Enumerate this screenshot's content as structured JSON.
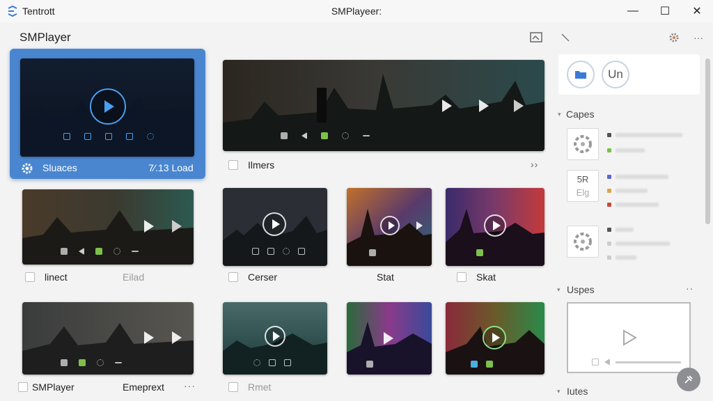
{
  "titlebar": {
    "app_name": "Tentrott",
    "window_title": "SMPlayeer:",
    "minimize_glyph": "—",
    "maximize_glyph": "☐",
    "close_glyph": "✕"
  },
  "header": {
    "title": "SMPlayer",
    "icons": [
      "screenshot-icon",
      "pencil-icon",
      "settings-icon",
      "more-icon"
    ],
    "more_glyph": "···"
  },
  "selected_card": {
    "label": "Sluaces",
    "status": "7⁄.13 Load",
    "icon": "gear-icon"
  },
  "cards": [
    {
      "id": "wide-top",
      "label": "Ilmers",
      "more": "››"
    },
    {
      "id": "row2-c1",
      "label": "linect",
      "meta": "Eilad"
    },
    {
      "id": "row2-c2",
      "label": "Cerser"
    },
    {
      "id": "row2-c3",
      "label": "Stat"
    },
    {
      "id": "row2-c4",
      "label": "Skat"
    },
    {
      "id": "row3-c1",
      "label": "SMPlayer",
      "meta": "Emeprext",
      "more": "···"
    },
    {
      "id": "row3-c2",
      "label": "Rmet"
    }
  ],
  "right_panel": {
    "top_button_text": "Un",
    "sections": [
      {
        "title": "Capes",
        "arrow": "▾"
      },
      {
        "title": "Uspes",
        "arrow": "▾",
        "more": "··"
      },
      {
        "title": "Iutes"
      }
    ],
    "tile_texts": [
      "5R",
      "Elg"
    ]
  },
  "colors": {
    "accent": "#4a86cf",
    "window_bg": "#f3f3f3",
    "card_green": "#7dc04b"
  }
}
